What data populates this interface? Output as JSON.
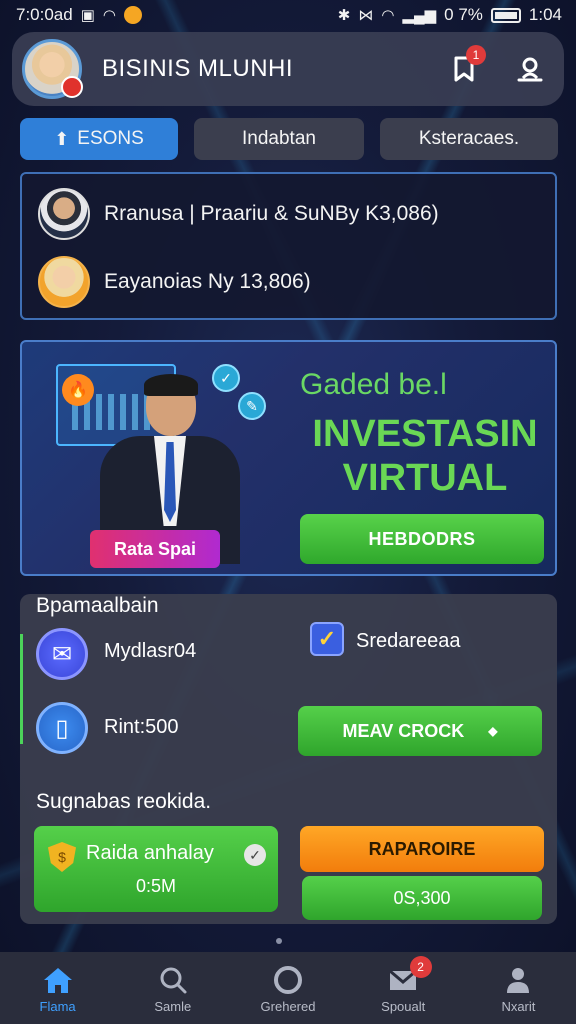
{
  "status_bar": {
    "left_text": "7:0:0ad",
    "battery_text": "0 7%",
    "time": "1:04"
  },
  "header": {
    "title": "BISINIS MLUNHI",
    "notification_count": "1"
  },
  "tabs": [
    {
      "label": "ESONS",
      "active": true
    },
    {
      "label": "Indabtan",
      "active": false
    },
    {
      "label": "Ksteracaes.",
      "active": false
    }
  ],
  "feed": [
    {
      "text": "Rranusa | Praariu & SuNBy K3,086)"
    },
    {
      "text": "Eayanoias Ny 13,806)"
    }
  ],
  "promo": {
    "tag": "Rata Spai",
    "subtitle": "Gaded be.l",
    "title": "INVESTASIN VIRTUAL",
    "button": "HEBDODRS"
  },
  "services": {
    "heading": "Bpamaalbain",
    "item1": "Mydlasr04",
    "item2": "Rint:500",
    "check_label": "Sredareeaa",
    "green_button": "MEAV CROCK",
    "sub_heading": "Sugnabas reokida.",
    "card_label": "Raida anhalay",
    "card_value": "0:5M",
    "orange_button": "RAPAROIRE",
    "value_button": "0S,300"
  },
  "bottom_nav": [
    {
      "label": "Flama",
      "icon": "home-icon",
      "active": true
    },
    {
      "label": "Samle",
      "icon": "search-icon",
      "active": false
    },
    {
      "label": "Grehered",
      "icon": "circle-icon",
      "active": false
    },
    {
      "label": "Spoualt",
      "icon": "mail-icon",
      "active": false,
      "badge": "2"
    },
    {
      "label": "Nxarit",
      "icon": "profile-icon",
      "active": false
    }
  ],
  "colors": {
    "accent_blue": "#2f7fd8",
    "green": "#4cc944",
    "orange": "#f59a1c",
    "badge_red": "#e03b3b"
  }
}
